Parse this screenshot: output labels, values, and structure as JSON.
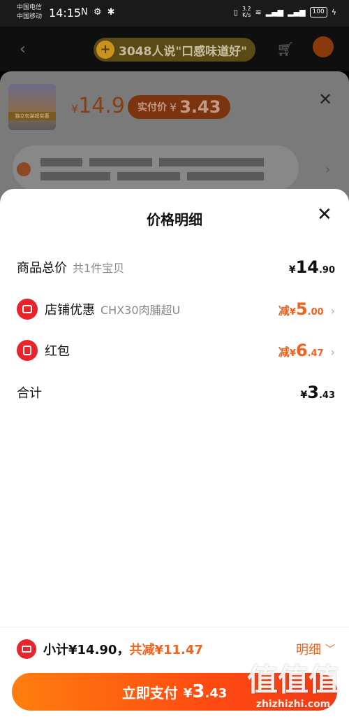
{
  "status_bar": {
    "carrier1": "中国电信",
    "carrier2": "中国移动",
    "time": "14:15",
    "left_icons": "N ⚙ ✱",
    "net_speed_value": "3.2",
    "net_speed_unit": "K/s",
    "battery": "100"
  },
  "top_bar": {
    "promo_text": "3048人说\"口感味道好\"",
    "promo_badge": "+"
  },
  "product": {
    "thumb_strip": "独立包装超实惠",
    "price_yen": "¥",
    "price": "14.9",
    "real_price_label": "实付价",
    "real_price_yen": "¥",
    "real_price": "3.43"
  },
  "sheet": {
    "title": "价格明细",
    "rows": [
      {
        "label": "商品总价",
        "sub": "共1件宝贝",
        "yen": "¥",
        "int": "14",
        "dec": ".90"
      },
      {
        "label": "店铺优惠",
        "sub": "CHX30肉脯超U",
        "prefix": "减",
        "yen": "¥",
        "int": "5",
        "dec": ".00"
      },
      {
        "label": "红包",
        "prefix": "减",
        "yen": "¥",
        "int": "6",
        "dec": ".47"
      },
      {
        "label": "合计",
        "yen": "¥",
        "int": "3",
        "dec": ".43"
      }
    ],
    "summary": {
      "subtotal": "小计¥14.90，",
      "discount": "共减¥11.47",
      "detail": "明细"
    },
    "pay": {
      "label": "立即支付",
      "yen": "¥",
      "int": "3",
      "dec": ".43"
    }
  },
  "watermark": {
    "glyphs": "值值值",
    "site": "zhizhizhi.com"
  },
  "colors": {
    "accent_orange": "#f0621e",
    "brand_red": "#e8232a",
    "pay_gradient_start": "#ff7e0f",
    "pay_gradient_end": "#f03a16"
  }
}
